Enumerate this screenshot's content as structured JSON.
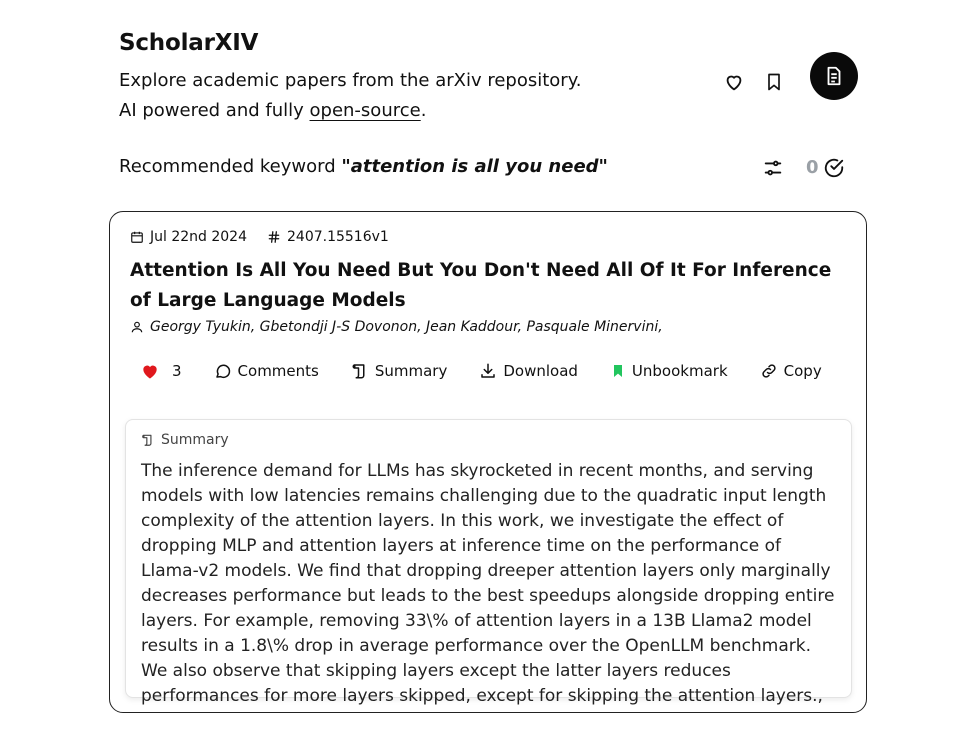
{
  "header": {
    "brand": "ScholarXIV",
    "tagline_line1": "Explore academic papers from the arXiv repository.",
    "tagline_prefix": "AI powered and fully ",
    "tagline_link": "open-source",
    "tagline_suffix": "."
  },
  "recommendation": {
    "label": "Recommended keyword ",
    "keyword": "\"attention is all you need\"",
    "done_count": "0"
  },
  "paper": {
    "date": "Jul 22nd 2024",
    "id": "2407.15516v1",
    "title": "Attention Is All You Need But You Don't Need All Of It For Inference of Large Language Models",
    "authors": "Georgy Tyukin, Gbetondji J-S Dovonon, Jean Kaddour, Pasquale Minervini,",
    "actions": {
      "likes": "3",
      "comments": "Comments",
      "summary": "Summary",
      "download": "Download",
      "bookmark": "Unbookmark",
      "copy": "Copy"
    },
    "summary_label": "Summary",
    "summary_text": "The inference demand for LLMs has skyrocketed in recent months, and serving models with low latencies remains challenging due to the quadratic input length complexity of the attention layers. In this work, we investigate the effect of dropping MLP and attention layers at inference time on the performance of Llama-v2 models. We find that dropping dreeper attention layers only marginally decreases performance but leads to the best speedups alongside dropping entire layers. For example, removing 33\\% of attention layers in a 13B Llama2 model results in a 1.8\\% drop in average performance over the OpenLLM benchmark. We also observe that skipping layers except the latter layers reduces performances for more layers skipped, except for skipping the attention layers.,"
  },
  "colors": {
    "like": "#e0181d",
    "bookmark": "#22c55e",
    "muted": "#9aa0a6"
  }
}
